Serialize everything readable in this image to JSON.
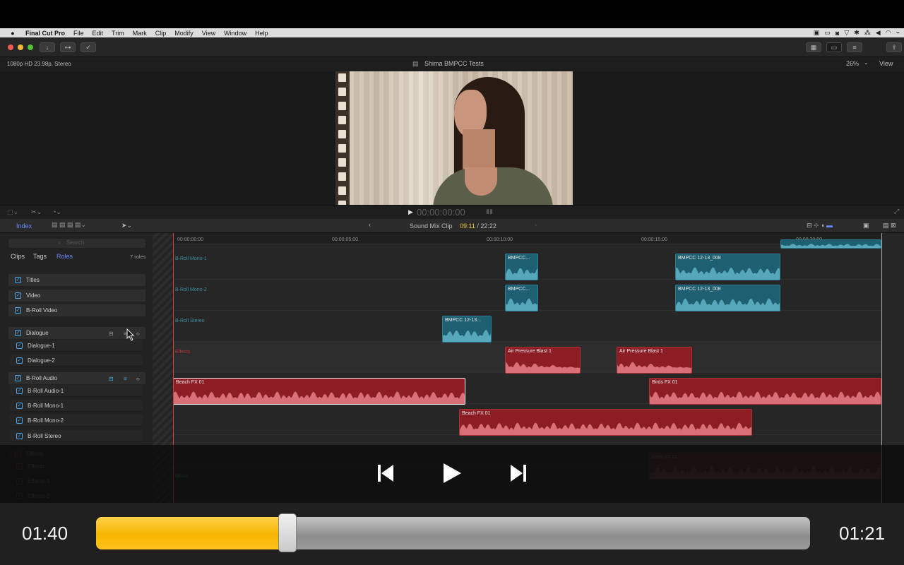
{
  "menubar": {
    "app_name": "Final Cut Pro",
    "items": [
      "File",
      "Edit",
      "Trim",
      "Mark",
      "Clip",
      "Modify",
      "View",
      "Window",
      "Help"
    ]
  },
  "viewer": {
    "format": "1080p HD 23.98p, Stereo",
    "project_title": "Shima BMPCC Tests",
    "zoom": "26%",
    "view_menu": "View",
    "timecode": "00:00:00:00"
  },
  "timeline_header": {
    "index_tab": "Index",
    "clip_title": "Sound Mix Clip",
    "clip_time_current": "09:11",
    "clip_time_separator": " / ",
    "clip_time_total": "22:22"
  },
  "roles_panel": {
    "search_placeholder": "Search",
    "tabs": [
      "Clips",
      "Tags",
      "Roles"
    ],
    "roles_count": "7 roles",
    "roles": [
      {
        "label": "Titles",
        "sub": false
      },
      {
        "label": "Video",
        "sub": false
      },
      {
        "label": "B-Roll Video",
        "sub": false
      },
      {
        "label": "Dialogue",
        "sub": false
      },
      {
        "label": "Dialogue-1",
        "sub": true
      },
      {
        "label": "Dialogue-2",
        "sub": true
      },
      {
        "label": "B-Roll Audio",
        "sub": false
      },
      {
        "label": "B-Roll Audio-1",
        "sub": true
      },
      {
        "label": "B-Roll Mono-1",
        "sub": true
      },
      {
        "label": "B-Roll Mono-2",
        "sub": true
      },
      {
        "label": "B-Roll Stereo",
        "sub": true
      },
      {
        "label": "Effects",
        "sub": false
      },
      {
        "label": "Effects",
        "sub": true
      },
      {
        "label": "Effects-1",
        "sub": true
      },
      {
        "label": "Effects-2",
        "sub": true
      }
    ]
  },
  "ruler": {
    "ticks": [
      "00:00:00:00",
      "00:00:05:00",
      "00:00:10:00",
      "00:00:15:00",
      "00:00:20:00"
    ]
  },
  "lanes": [
    {
      "label": "B-Roll Mono-1",
      "color": "#3f8ea3"
    },
    {
      "label": "B-Roll Mono-2",
      "color": "#3f8ea3"
    },
    {
      "label": "B-Roll Stereo",
      "color": "#3f8ea3"
    },
    {
      "label": "Effects",
      "color": "#b8333d"
    },
    {
      "label": "",
      "color": "#b8333d"
    },
    {
      "label": "",
      "color": "#b8333d"
    },
    {
      "label": "",
      "color": "#b8333d"
    },
    {
      "label": "Music",
      "color": "#3e8a3e"
    }
  ],
  "clips": [
    {
      "name": "BMPCC...",
      "kind": "teal"
    },
    {
      "name": "BMPCC 12-13_008",
      "kind": "teal"
    },
    {
      "name": "BMPCC...",
      "kind": "teal"
    },
    {
      "name": "BMPCC 12-13_008",
      "kind": "teal"
    },
    {
      "name": "BMPCC 12-13...",
      "kind": "teal"
    },
    {
      "name": "Air Pressure Blast 1",
      "kind": "red"
    },
    {
      "name": "Air Pressure Blast 1",
      "kind": "red"
    },
    {
      "name": "Beach FX 01",
      "kind": "red"
    },
    {
      "name": "Birds FX 01",
      "kind": "red"
    },
    {
      "name": "Beach FX 01",
      "kind": "red"
    },
    {
      "name": "Birds FX 01",
      "kind": "red"
    },
    {
      "name": "",
      "kind": "teal"
    }
  ],
  "player": {
    "elapsed": "01:40",
    "remaining": "01:21",
    "progress": 0.268,
    "accent": "#f5b400"
  }
}
